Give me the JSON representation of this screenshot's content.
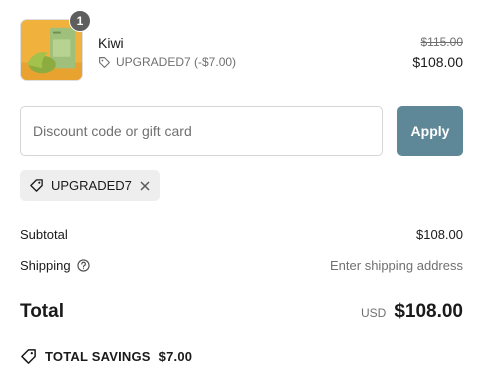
{
  "cart": {
    "item": {
      "quantity": "1",
      "name": "Kiwi",
      "discount_label": "UPGRADED7 (-$7.00)",
      "original_price": "$115.00",
      "price": "$108.00",
      "image_icon": "product-image"
    }
  },
  "discount": {
    "placeholder": "Discount code or gift card",
    "value": "",
    "apply_label": "Apply",
    "applied_code": "UPGRADED7"
  },
  "summary": {
    "subtotal_label": "Subtotal",
    "subtotal_value": "$108.00",
    "shipping_label": "Shipping",
    "shipping_value": "Enter shipping address",
    "total_label": "Total",
    "currency": "USD",
    "total_value": "$108.00",
    "savings_label": "TOTAL SAVINGS",
    "savings_value": "$7.00"
  },
  "colors": {
    "apply_button": "#5e8798",
    "chip_background": "#eeeeee",
    "thumb_background": "#f2b13a"
  }
}
